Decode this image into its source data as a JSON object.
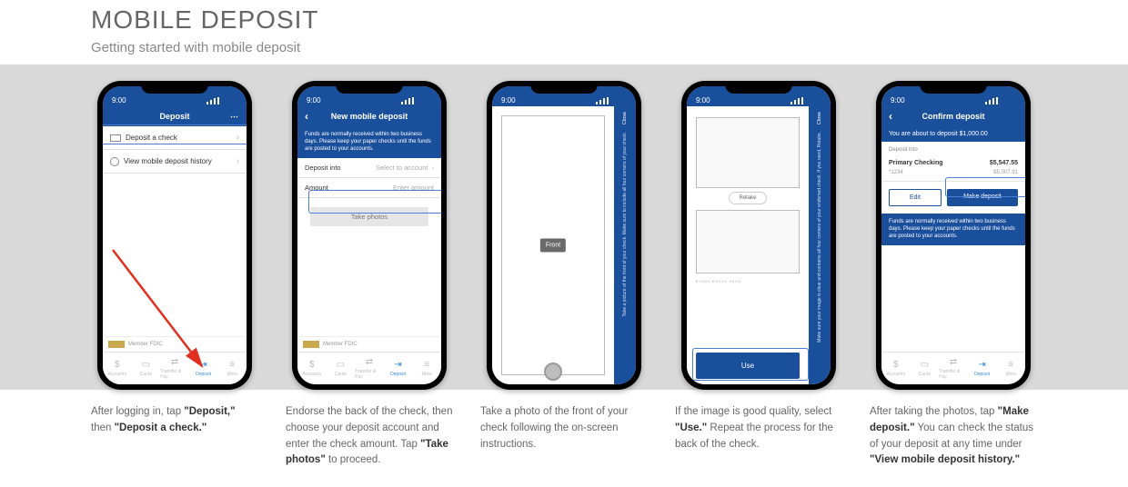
{
  "header": {
    "title": "MOBILE DEPOSIT",
    "subtitle": "Getting started with mobile deposit"
  },
  "status": {
    "time": "9:00"
  },
  "tabs": {
    "accounts": "Accounts",
    "cards": "Cards",
    "transfer": "Transfer & Pay",
    "deposit": "Deposit",
    "more": "More"
  },
  "fdic": {
    "label": "Member FDIC"
  },
  "screen1": {
    "nav_title": "Deposit",
    "row_deposit_check": "Deposit a check",
    "row_history": "View mobile deposit history"
  },
  "screen2": {
    "nav_title": "New mobile deposit",
    "info_text": "Funds are normally received within two business days. Please keep your paper checks until the funds are posted to your accounts.",
    "into_label": "Deposit into",
    "into_value": "Select to account",
    "amount_label": "Amount",
    "amount_value": "Enter amount",
    "take_photos": "Take photos"
  },
  "screen3": {
    "close": "Close",
    "front_label": "Front",
    "side_instr": "Take a picture of the front of your check. Make sure to include all four corners of your check."
  },
  "screen4": {
    "close": "Close",
    "retake": "Retake",
    "use": "Use",
    "side_instr": "Make sure your image is clear and contains all four corners of your endorsed check. If you need, Retake."
  },
  "screen5": {
    "nav_title": "Confirm deposit",
    "about": "You are about to deposit $1,000.00",
    "into_label": "Deposit into",
    "acct_name": "Primary Checking",
    "acct_bal": "$5,547.55",
    "acct_mask": "*1234",
    "acct_after": "$5,007.91",
    "edit": "Edit",
    "make_deposit": "Make deposit",
    "info_text": "Funds are normally received within two business days. Please keep your paper checks until the funds are posted to your accounts."
  },
  "captions": {
    "c1_a": "After logging in, tap ",
    "c1_b": "\"Deposit,\"",
    "c1_c": " then ",
    "c1_d": "\"Deposit a check.\"",
    "c2_a": "Endorse the back of the check, then choose your deposit account and enter the check amount. Tap ",
    "c2_b": "\"Take photos\"",
    "c2_c": " to proceed.",
    "c3": "Take a photo of the front of your check following the on-screen instructions.",
    "c4_a": "If the image is good quality, select ",
    "c4_b": "\"Use.\"",
    "c4_c": " Repeat the process for the back of the check.",
    "c5_a": "After taking the photos, tap ",
    "c5_b": "\"Make deposit.\"",
    "c5_c": " You can check the status of your deposit at any time under ",
    "c5_d": "\"View mobile deposit history.\""
  }
}
